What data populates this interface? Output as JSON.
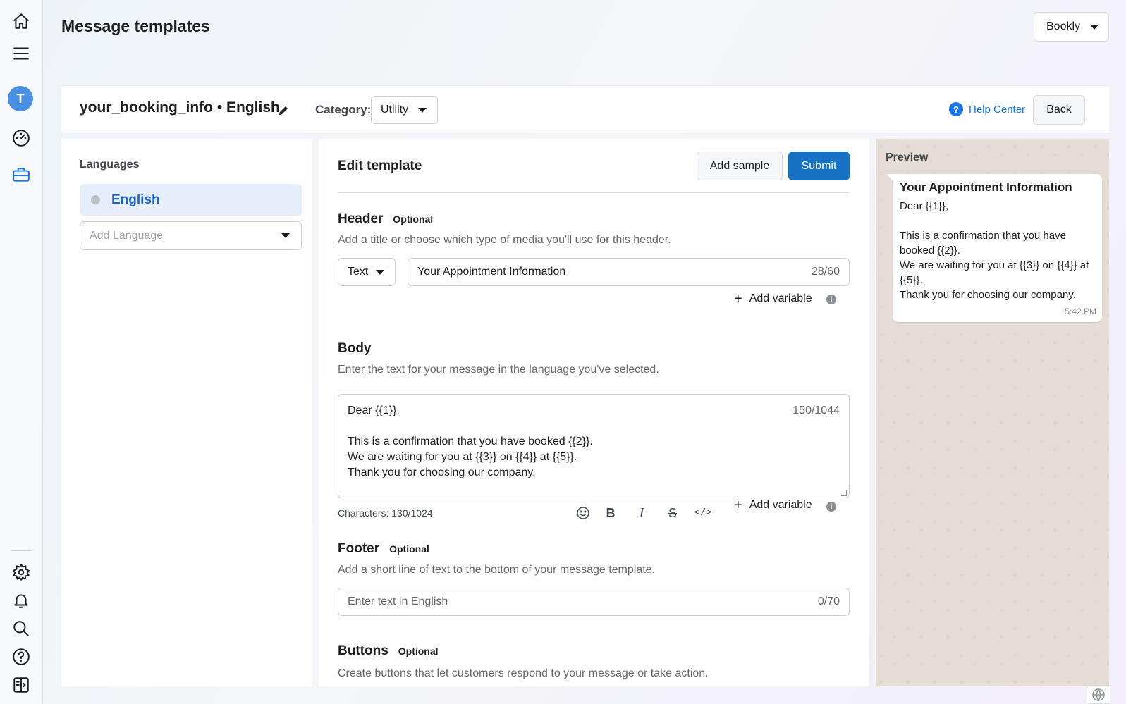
{
  "page": {
    "title": "Message templates"
  },
  "account": {
    "label": "Bookly"
  },
  "nav": {
    "avatar_letter": "T"
  },
  "template": {
    "name": "your_booking_info • English",
    "category_label": "Category:",
    "category_value": "Utility",
    "help_center": "Help Center",
    "back": "Back"
  },
  "languages": {
    "title": "Languages",
    "items": [
      {
        "label": "English"
      }
    ],
    "add_placeholder": "Add Language"
  },
  "editor": {
    "title": "Edit template",
    "add_sample": "Add sample",
    "submit": "Submit",
    "header": {
      "title": "Header",
      "optional": "Optional",
      "description": "Add a title or choose which type of media you'll use for this header.",
      "type_value": "Text",
      "input_value": "Your Appointment Information",
      "counter": "28/60",
      "add_variable": "Add variable"
    },
    "body": {
      "title": "Body",
      "description": "Enter the text for your message in the language you've selected.",
      "lines": [
        "Dear {{1}},",
        "",
        "This is a confirmation that you have booked {{2}}.",
        "We are waiting for you at {{3}} on {{4}} at {{5}}.",
        "Thank you for choosing our company."
      ],
      "counter": "150/1044",
      "characters": "Characters: 130/1024",
      "add_variable": "Add variable"
    },
    "footer": {
      "title": "Footer",
      "optional": "Optional",
      "description": "Add a short line of text to the bottom of your message template.",
      "placeholder": "Enter text in English",
      "counter": "0/70"
    },
    "buttons": {
      "title": "Buttons",
      "optional": "Optional",
      "description": "Create buttons that let customers respond to your message or take action."
    }
  },
  "preview": {
    "title": "Preview",
    "header": "Your Appointment Information",
    "lines": [
      "Dear {{1}},",
      "",
      "This is a confirmation that you have booked {{2}}.",
      "We are waiting for you at {{3}} on {{4}} at {{5}}.",
      "Thank you for choosing our company."
    ],
    "time": "5:42 PM"
  },
  "icons": {
    "rail": [
      "home-icon",
      "menu-icon",
      "dashboard-gauge-icon",
      "briefcase-icon",
      "settings-icon",
      "bell-icon",
      "search-icon",
      "help-icon",
      "panel-toggle-icon"
    ],
    "toolbar": [
      "emoji-icon",
      "bold-icon",
      "italic-icon",
      "strikethrough-icon",
      "code-icon"
    ]
  },
  "colors": {
    "accent": "#1671c4",
    "link": "#1b74e4",
    "avatar": "#4a90e2",
    "preview_bg": "#e5ddd5"
  }
}
